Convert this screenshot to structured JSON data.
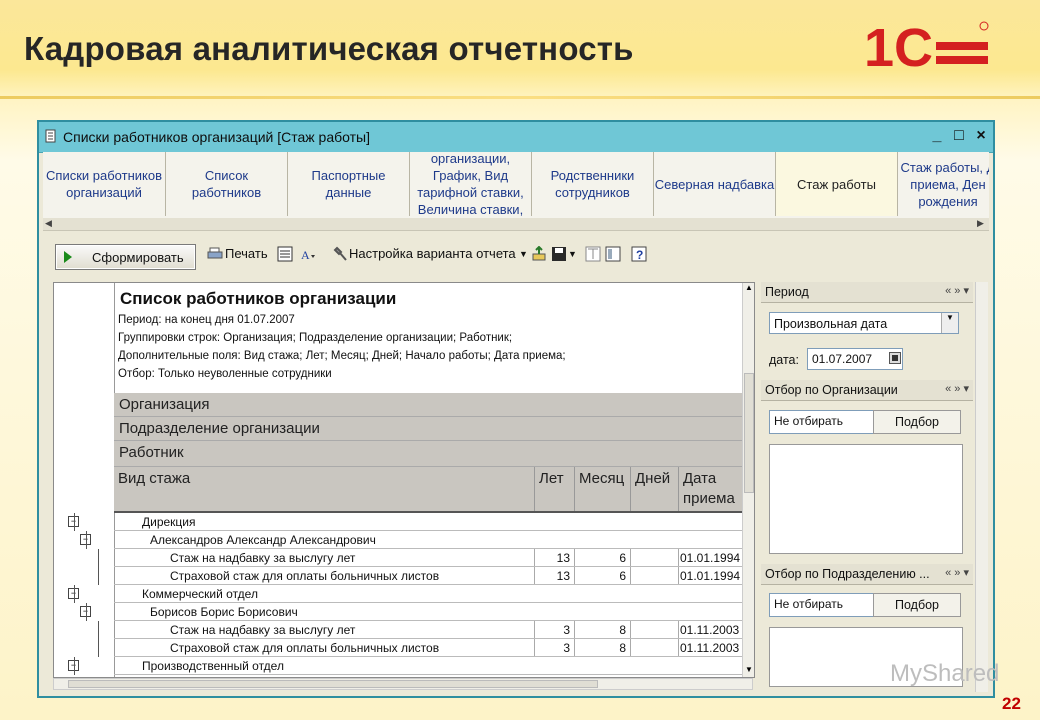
{
  "slide": {
    "title": "Кадровая аналитическая отчетность",
    "page_number": "22",
    "logo_text": "1С",
    "watermark": "MyShared"
  },
  "window": {
    "title": "Списки работников организаций [Стаж работы]",
    "controls": [
      "_",
      "□",
      "×"
    ]
  },
  "tabs": [
    {
      "label": "Списки работников\nорганизаций"
    },
    {
      "label": "Список\nработников"
    },
    {
      "label": "Паспортные\nданные"
    },
    {
      "label": "организации,\nГрафик, Вид\nтарифной ставки,\nВеличина ставки,"
    },
    {
      "label": "Родственники\nсотрудников"
    },
    {
      "label": "Северная надбавка"
    },
    {
      "label": "Стаж работы",
      "active": true
    },
    {
      "label": "Стаж работы, Д\nприема, Ден\nрождения"
    }
  ],
  "toolbar": {
    "form_button": "Сформировать",
    "print": "Печать",
    "settings": "Настройка варианта отчета"
  },
  "report": {
    "title": "Список работников организации",
    "lines": [
      "Период: на конец дня 01.07.2007",
      "Группировки строк: Организация; Подразделение организации; Работник;",
      "Дополнительные поля: Вид стажа; Лет; Месяц; Дней; Начало работы; Дата приема;",
      "Отбор: Только неуволенные сотрудники"
    ],
    "groups": [
      "Организация",
      "Подразделение организации",
      "Работник"
    ],
    "columns": [
      "Вид стажа",
      "Лет",
      "Месяц",
      "Дней",
      "Дата\nприема"
    ],
    "rows": [
      {
        "name": "Дирекция",
        "level": 1,
        "years": "",
        "months": "",
        "date": ""
      },
      {
        "name": "Александров Александр Александрович",
        "level": 2,
        "years": "",
        "months": "",
        "date": ""
      },
      {
        "name": "Стаж на надбавку за выслугу лет",
        "level": 3,
        "years": "13",
        "months": "6",
        "date": "01.01.1994"
      },
      {
        "name": "Страховой стаж для оплаты больничных листов",
        "level": 3,
        "years": "13",
        "months": "6",
        "date": "01.01.1994"
      },
      {
        "name": "Коммерческий отдел",
        "level": 1,
        "years": "",
        "months": "",
        "date": ""
      },
      {
        "name": "Борисов Борис Борисович",
        "level": 2,
        "years": "",
        "months": "",
        "date": ""
      },
      {
        "name": "Стаж на надбавку за выслугу лет",
        "level": 3,
        "years": "3",
        "months": "8",
        "date": "01.11.2003"
      },
      {
        "name": "Страховой стаж для оплаты больничных листов",
        "level": 3,
        "years": "3",
        "months": "8",
        "date": "01.11.2003"
      },
      {
        "name": "Производственный отдел",
        "level": 1,
        "years": "",
        "months": "",
        "date": ""
      }
    ]
  },
  "panel": {
    "period_header": "Период",
    "period_type": "Произвольная дата",
    "date_label": "дата:",
    "date_value": "01.07.2007",
    "org_header": "Отбор по Организации",
    "org_value": "Не отбирать",
    "org_pick": "Подбор",
    "dept_header": "Отбор по Подразделению ...",
    "dept_value": "Не отбирать",
    "dept_pick": "Подбор",
    "header_controls": "« » ▾"
  }
}
